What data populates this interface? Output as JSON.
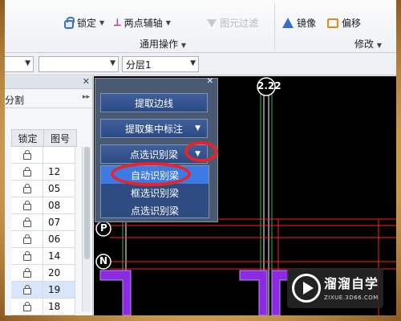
{
  "ribbon": {
    "lock_label": "锁定",
    "two_point_aux_label": "两点辅轴",
    "filter_label": "图元过滤",
    "mirror_label": "镜像",
    "offset_label": "偏移",
    "group_general": "通用操作",
    "group_modify": "修改",
    "icons": {
      "lock": "lock-icon",
      "aux": "two-point-axis-icon",
      "filter": "filter-icon",
      "mirror": "mirror-icon",
      "offset": "offset-icon"
    }
  },
  "toolbar": {
    "combo1": "",
    "combo2": "",
    "layer": "分层1"
  },
  "left_panel": {
    "sub_label": "分割",
    "columns": [
      "锁定",
      "图号"
    ],
    "rows": [
      {
        "code": ""
      },
      {
        "code": "12"
      },
      {
        "code": "05"
      },
      {
        "code": "08"
      },
      {
        "code": "07"
      },
      {
        "code": "06"
      },
      {
        "code": "14"
      },
      {
        "code": "20"
      },
      {
        "code": "19"
      },
      {
        "code": "18"
      }
    ]
  },
  "float_panel": {
    "extract_edge": "提取边线",
    "extract_annotation": "提取集中标注",
    "point_identify_beam": "点选识别梁",
    "menu": [
      "自动识别梁",
      "框选识别梁",
      "点选识别梁"
    ]
  },
  "canvas": {
    "axis_top": "2.22",
    "axis_p": "P",
    "axis_n": "N",
    "colors": {
      "line_red": "#ff2020",
      "line_white": "#ffffff",
      "column_purple": "#8a2be2",
      "axis_green": "#2fbf4a"
    }
  },
  "logo": {
    "name_cn": "溜溜自学",
    "name_en": "ZIXUE.3D66.COM"
  },
  "annotations": {
    "color": "#e8232a"
  }
}
